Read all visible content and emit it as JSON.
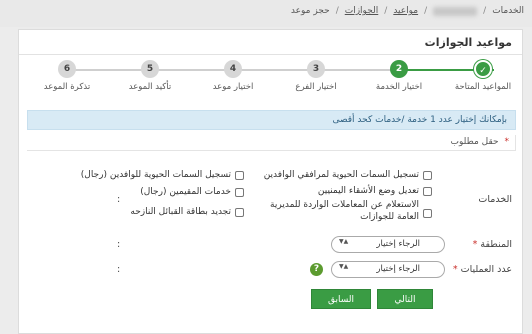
{
  "breadcrumb": {
    "items": [
      "الخدمات",
      "مواعيد",
      "الجوازات",
      "حجز موعد"
    ]
  },
  "page": {
    "title": "مواعيد الجوازات"
  },
  "stepper": {
    "steps": [
      {
        "number": "✓",
        "label": "المواعيد المتاحة",
        "state": "done"
      },
      {
        "number": "2",
        "label": "اختيار الخدمة",
        "state": "active"
      },
      {
        "number": "3",
        "label": "اختيار الفرع",
        "state": "pending"
      },
      {
        "number": "4",
        "label": "اختيار موعد",
        "state": "pending"
      },
      {
        "number": "5",
        "label": "تأكيد الموعد",
        "state": "pending"
      },
      {
        "number": "6",
        "label": "تذكرة الموعد",
        "state": "pending"
      }
    ]
  },
  "info": {
    "text": "بإمكانك إختيار عدد 1 خدمة /خدمات كحد أقصى"
  },
  "required_note": {
    "star": "*",
    "text": "حقل مطلوب"
  },
  "services": {
    "label": "الخدمات",
    "colon": ":",
    "options": [
      "تسجيل السمات الحيوية لمرافقي الوافدين",
      "تسجيل السمات الحيوية للوافدين (رجال)",
      "تعديل وضع الأشقاء اليمنيين",
      "خدمات المقيمين (رجال)",
      "الاستعلام عن المعاملات الواردة للمديرية العامة للجوازات",
      "تجديد بطاقة القبائل النازحه"
    ]
  },
  "region": {
    "label": "المنطقة",
    "star": "*",
    "colon": ":",
    "value": "الرجاء إختيار",
    "arrows": "▲▼"
  },
  "operations": {
    "label": "عدد العمليات",
    "star": "*",
    "colon": ":",
    "value": "الرجاء إختيار",
    "arrows": "▲▼",
    "help_icon": "?"
  },
  "buttons": {
    "next": "التالي",
    "previous": "السابق"
  },
  "colors": {
    "accent": "#3a9c44",
    "info_bg": "#d8eaf5"
  }
}
